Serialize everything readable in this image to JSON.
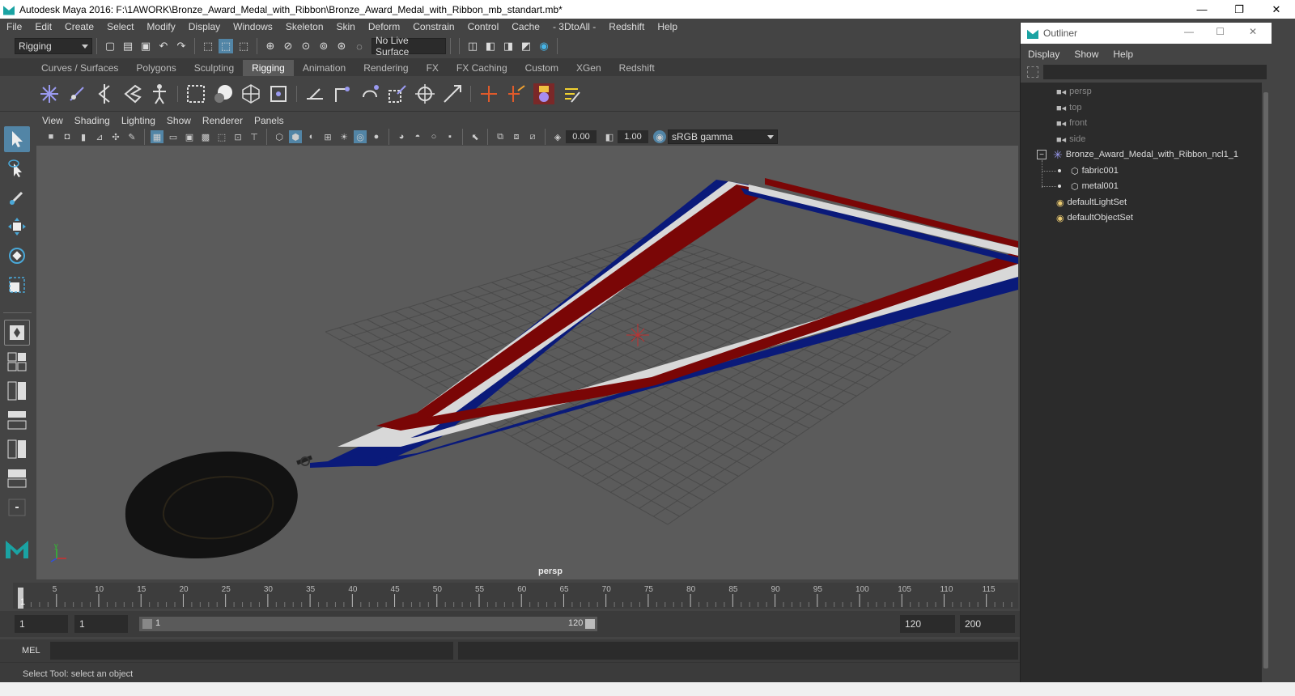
{
  "window": {
    "title": "Autodesk Maya 2016: F:\\1AWORK\\Bronze_Award_Medal_with_Ribbon\\Bronze_Award_Medal_with_Ribbon_mb_standart.mb*",
    "minimize": "—",
    "restore": "❐",
    "close": "✕"
  },
  "menubar": [
    "File",
    "Edit",
    "Create",
    "Select",
    "Modify",
    "Display",
    "Windows",
    "Skeleton",
    "Skin",
    "Deform",
    "Constrain",
    "Control",
    "Cache",
    "- 3DtoAll -",
    "Redshift",
    "Help"
  ],
  "statusline": {
    "menu_set": "Rigging",
    "live_surface": "No Live Surface"
  },
  "shelf_tabs": [
    "Curves / Surfaces",
    "Polygons",
    "Sculpting",
    "Rigging",
    "Animation",
    "Rendering",
    "FX",
    "FX Caching",
    "Custom",
    "XGen",
    "Redshift"
  ],
  "shelf_active": "Rigging",
  "viewport": {
    "menu": [
      "View",
      "Shading",
      "Lighting",
      "Show",
      "Renderer",
      "Panels"
    ],
    "exposure": "0.00",
    "gamma": "1.00",
    "color_space": "sRGB gamma",
    "camera_label": "persp",
    "axis_y": "y",
    "colors": {
      "blue": "#0a1a7a",
      "white": "#d8d8d8",
      "red": "#7a0606",
      "grid": "#4a4a4a",
      "medal": "#121212"
    }
  },
  "timeline": {
    "ticks": [
      "1",
      "5",
      "10",
      "15",
      "20",
      "25",
      "30",
      "35",
      "40",
      "45",
      "50",
      "55",
      "60",
      "65",
      "70",
      "75",
      "80",
      "85",
      "90",
      "95",
      "100",
      "105",
      "110",
      "115"
    ],
    "current_frame": "1"
  },
  "range": {
    "start": "1",
    "playback_start": "1",
    "slider_start": "1",
    "slider_end": "120",
    "playback_end": "120",
    "end": "200"
  },
  "cmdline": {
    "label": "MEL"
  },
  "helpline": {
    "text": "Select Tool: select an object"
  },
  "outliner": {
    "title": "Outliner",
    "menu": [
      "Display",
      "Show",
      "Help"
    ],
    "items": [
      {
        "label": "persp",
        "dim": true
      },
      {
        "label": "top",
        "dim": true
      },
      {
        "label": "front",
        "dim": true
      },
      {
        "label": "side",
        "dim": true
      },
      {
        "label": "Bronze_Award_Medal_with_Ribbon_ncl1_1",
        "dim": false
      },
      {
        "label": "fabric001",
        "dim": false
      },
      {
        "label": "metal001",
        "dim": false
      },
      {
        "label": "defaultLightSet",
        "dim": false
      },
      {
        "label": "defaultObjectSet",
        "dim": false
      }
    ]
  }
}
